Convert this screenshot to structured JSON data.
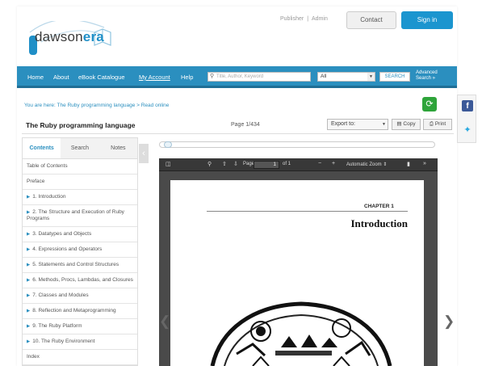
{
  "brand": {
    "logo_part1": "dawson",
    "logo_part2": "era"
  },
  "header": {
    "publisher_link": "Publisher",
    "separator": "|",
    "admin_link": "Admin",
    "contact": "Contact",
    "sign_in": "Sign in"
  },
  "nav": {
    "items": [
      "Home",
      "About",
      "eBook Catalogue",
      "My Account",
      "Help"
    ],
    "search_placeholder": "Title, Author, Keyword",
    "scope": "All",
    "search_button": "SEARCH",
    "advanced_line1": "Advanced",
    "advanced_line2": "Search »"
  },
  "breadcrumb": "You are here: The Ruby programming language > Read online",
  "book": {
    "title": "The Ruby programming language",
    "page_indicator": "Page 1/434",
    "export_label": "Export to:",
    "copy_label": "Copy",
    "print_label": "Print"
  },
  "sidebar": {
    "tabs": [
      "Contents",
      "Search",
      "Notes"
    ],
    "toc": [
      {
        "label": "Table of Contents",
        "expandable": false
      },
      {
        "label": "Preface",
        "expandable": false
      },
      {
        "label": "1. Introduction",
        "expandable": true
      },
      {
        "label": "2. The Structure and Execution of Ruby Programs",
        "expandable": true
      },
      {
        "label": "3. Datatypes and Objects",
        "expandable": true
      },
      {
        "label": "4. Expressions and Operators",
        "expandable": true
      },
      {
        "label": "5. Statements and Control Structures",
        "expandable": true
      },
      {
        "label": "6. Methods, Procs, Lambdas, and Closures",
        "expandable": true
      },
      {
        "label": "7. Classes and Modules",
        "expandable": true
      },
      {
        "label": "8. Reflection and Metaprogramming",
        "expandable": true
      },
      {
        "label": "9. The Ruby Platform",
        "expandable": true
      },
      {
        "label": "10. The Ruby Environment",
        "expandable": true
      },
      {
        "label": "Index",
        "expandable": false
      }
    ]
  },
  "viewer": {
    "page_label": "Page:",
    "page_value": "1",
    "page_of": "of 1",
    "zoom": "Automatic Zoom",
    "chapter_label": "CHAPTER 1",
    "chapter_title": "Introduction",
    "progress": 0.01
  },
  "colors": {
    "primary": "#2b8fbf",
    "share": "#2ea43a",
    "facebook": "#3b5998",
    "twitter": "#29a9e0"
  }
}
